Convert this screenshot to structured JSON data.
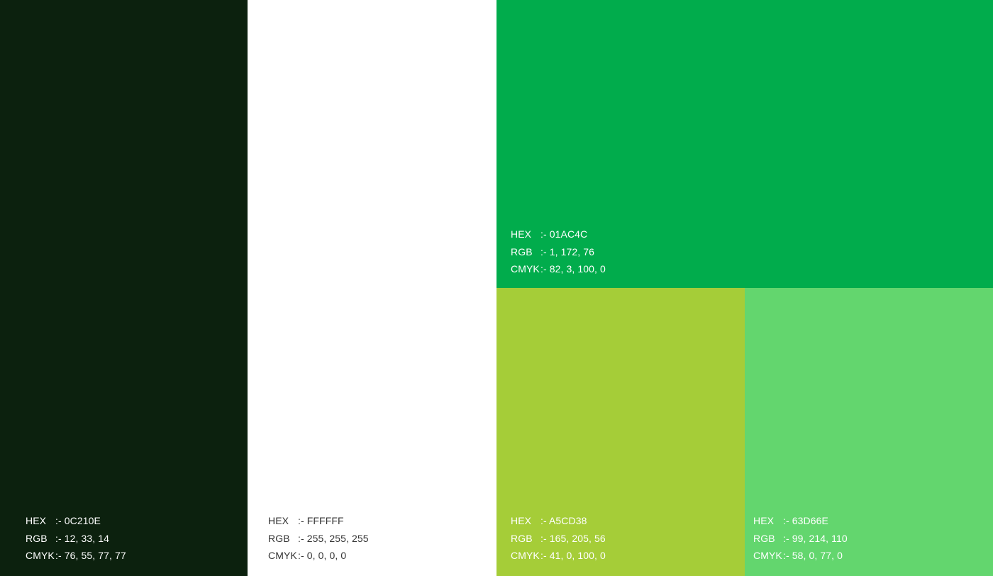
{
  "swatches": [
    {
      "id": "dark",
      "color": "#0C210E",
      "text_color": "#FFFFFF",
      "labels": {
        "hex": "HEX",
        "rgb": "RGB",
        "cmyk": "CMYK"
      },
      "hex": ":- 0C210E",
      "rgb": ":- 12, 33, 14",
      "cmyk": ":- 76, 55, 77, 77"
    },
    {
      "id": "white",
      "color": "#FFFFFF",
      "text_color": "#333333",
      "labels": {
        "hex": "HEX",
        "rgb": "RGB",
        "cmyk": "CMYK"
      },
      "hex": ":- FFFFFF",
      "rgb": ":- 255, 255, 255",
      "cmyk": ":- 0, 0, 0, 0"
    },
    {
      "id": "green",
      "color": "#01AC4C",
      "text_color": "#FFFFFF",
      "labels": {
        "hex": "HEX",
        "rgb": "RGB",
        "cmyk": "CMYK"
      },
      "hex": ":- 01AC4C",
      "rgb": ":- 1, 172, 76",
      "cmyk": ":- 82, 3, 100, 0"
    },
    {
      "id": "lime",
      "color": "#A5CD38",
      "text_color": "#FFFFFF",
      "labels": {
        "hex": "HEX",
        "rgb": "RGB",
        "cmyk": "CMYK"
      },
      "hex": ":- A5CD38",
      "rgb": ":- 165, 205, 56",
      "cmyk": ":- 41, 0, 100, 0"
    },
    {
      "id": "light-green",
      "color": "#63D66E",
      "text_color": "#FFFFFF",
      "labels": {
        "hex": "HEX",
        "rgb": "RGB",
        "cmyk": "CMYK"
      },
      "hex": ":- 63D66E",
      "rgb": ":- 99, 214, 110",
      "cmyk": ":- 58, 0, 77, 0"
    }
  ]
}
